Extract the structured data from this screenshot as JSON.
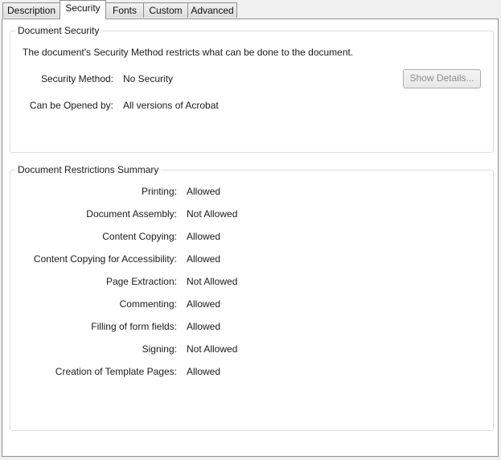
{
  "tabs": [
    {
      "label": "Description",
      "active": false
    },
    {
      "label": "Security",
      "active": true
    },
    {
      "label": "Fonts",
      "active": false
    },
    {
      "label": "Custom",
      "active": false
    },
    {
      "label": "Advanced",
      "active": false
    }
  ],
  "document_security": {
    "title": "Document Security",
    "description": "The document's Security Method restricts what can be done to the document.",
    "security_method_label": "Security Method:",
    "security_method_value": "No Security",
    "opened_by_label": "Can be Opened by:",
    "opened_by_value": "All versions of Acrobat",
    "show_details_label": "Show Details..."
  },
  "restrictions": {
    "title": "Document Restrictions Summary",
    "items": [
      {
        "label": "Printing:",
        "value": "Allowed"
      },
      {
        "label": "Document Assembly:",
        "value": "Not Allowed"
      },
      {
        "label": "Content Copying:",
        "value": "Allowed"
      },
      {
        "label": "Content Copying for Accessibility:",
        "value": "Allowed"
      },
      {
        "label": "Page Extraction:",
        "value": "Not Allowed"
      },
      {
        "label": "Commenting:",
        "value": "Allowed"
      },
      {
        "label": "Filling of form fields:",
        "value": "Allowed"
      },
      {
        "label": "Signing:",
        "value": "Not Allowed"
      },
      {
        "label": "Creation of Template Pages:",
        "value": "Allowed"
      }
    ]
  }
}
